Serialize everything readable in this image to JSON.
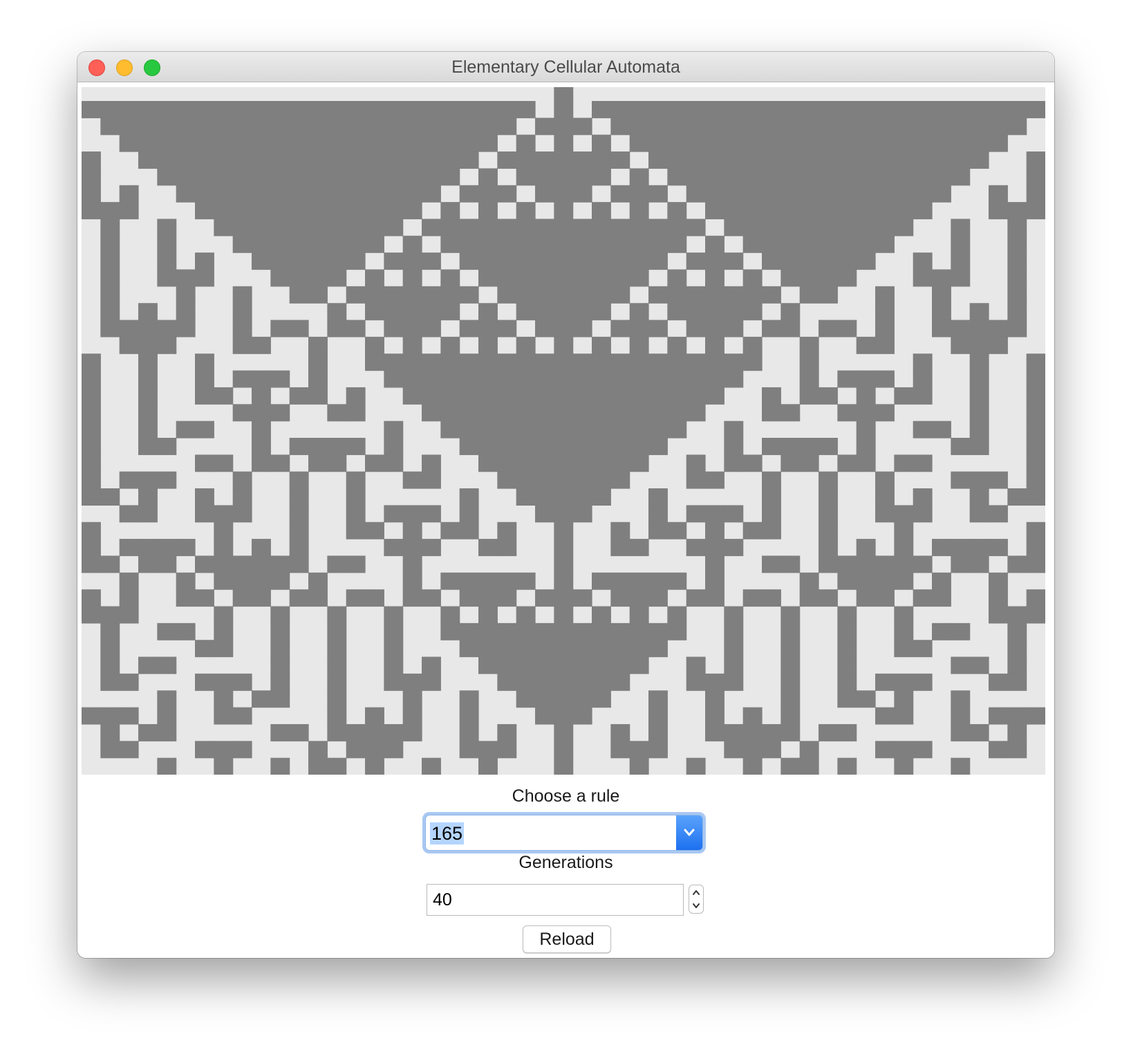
{
  "window": {
    "title": "Elementary Cellular Automata"
  },
  "automaton": {
    "rule": 165,
    "generations": 40,
    "columns": 51,
    "start": "single-cell-center",
    "colors": {
      "background": "#e8e8e8",
      "cell": "#7f7f7f"
    }
  },
  "controls": {
    "rule_label": "Choose a rule",
    "rule_value": "165",
    "generations_label": "Generations",
    "generations_value": "40",
    "reload_label": "Reload"
  },
  "icons": {
    "dropdown": "chevron-down-icon",
    "stepper_up": "chevron-up-icon",
    "stepper_down": "chevron-down-icon"
  }
}
